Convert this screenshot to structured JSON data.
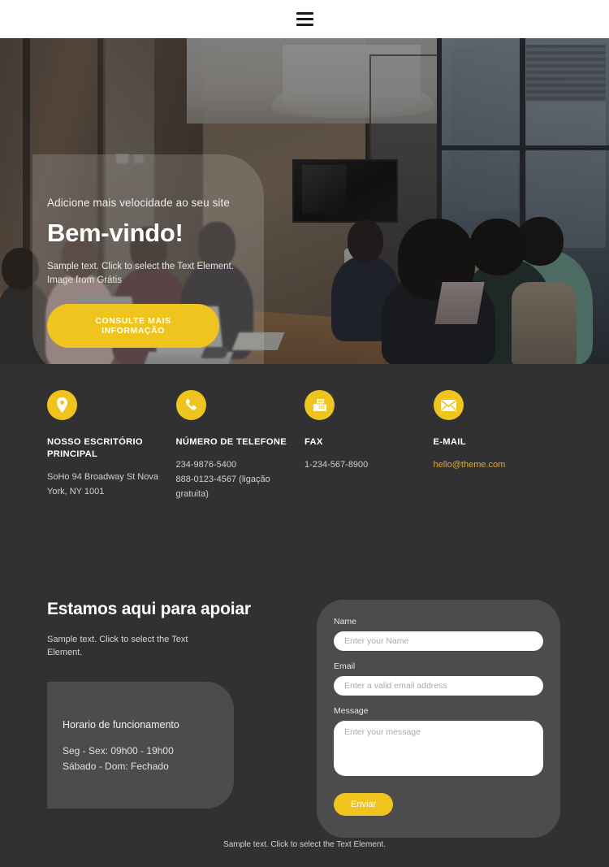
{
  "header": {
    "menu_icon": "hamburger-icon"
  },
  "hero": {
    "eyebrow": "Adicione mais velocidade ao seu site",
    "title": "Bem-vindo!",
    "subtitle_line1": "Sample text. Click to select the Text Element.",
    "subtitle_line2": "Image from Grátis",
    "cta_label": "CONSULTE MAIS INFORMAÇÃO"
  },
  "contact": {
    "items": [
      {
        "icon": "map-pin-icon",
        "title": "NOSSO ESCRITÓRIO PRINCIPAL",
        "body": "SoHo 94 Broadway St Nova York, NY 1001",
        "is_link": false
      },
      {
        "icon": "phone-icon",
        "title": "NÚMERO DE TELEFONE",
        "body": "234-9876-5400\n888-0123-4567 (ligação gratuita)",
        "is_link": false
      },
      {
        "icon": "fax-icon",
        "title": "FAX",
        "body": "1-234-567-8900",
        "is_link": false
      },
      {
        "icon": "envelope-icon",
        "title": "E-MAIL",
        "body": "hello@theme.com",
        "is_link": true
      }
    ]
  },
  "support": {
    "title": "Estamos aqui para apoiar",
    "subtitle": "Sample text. Click to select the Text Element.",
    "hours_title": "Horario de funcionamento",
    "hours_weekday": "Seg - Sex: 09h00 - 19h00",
    "hours_weekend": "Sábado - Dom: Fechado"
  },
  "form": {
    "name_label": "Name",
    "name_placeholder": "Enter your Name",
    "name_value": "",
    "email_label": "Email",
    "email_placeholder": "Enter a valid email address",
    "email_value": "",
    "message_label": "Message",
    "message_placeholder": "Enter your message",
    "message_value": "",
    "submit_label": "Enviar"
  },
  "footer": {
    "text": "Sample text. Click to select the Text Element."
  },
  "colors": {
    "accent": "#f0c41e",
    "page_bg": "#313133",
    "panel_bg": "#4c4c4c",
    "header_bg": "#ffffff",
    "email_link": "#d9a93a"
  }
}
